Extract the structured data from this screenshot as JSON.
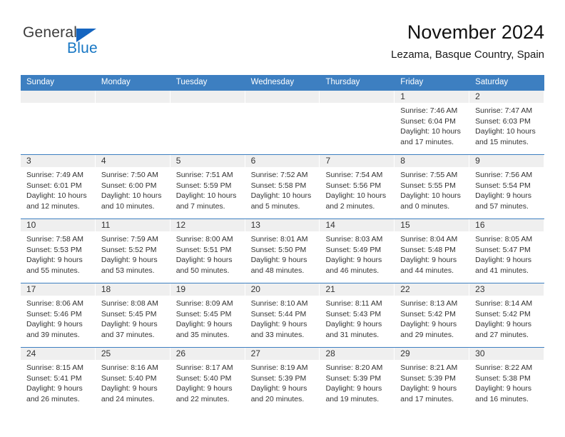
{
  "brand": {
    "name_part1": "General",
    "name_part2": "Blue"
  },
  "header": {
    "title": "November 2024",
    "subtitle": "Lezama, Basque Country, Spain"
  },
  "weekdays": [
    "Sunday",
    "Monday",
    "Tuesday",
    "Wednesday",
    "Thursday",
    "Friday",
    "Saturday"
  ],
  "colors": {
    "header_blue": "#3d7fc1",
    "band_gray": "#efefef",
    "brand_blue": "#1777c4",
    "logo_triangle": "#1565c0"
  },
  "weeks": [
    [
      {
        "day": "",
        "empty": true
      },
      {
        "day": "",
        "empty": true
      },
      {
        "day": "",
        "empty": true
      },
      {
        "day": "",
        "empty": true
      },
      {
        "day": "",
        "empty": true
      },
      {
        "day": "1",
        "sunrise": "Sunrise: 7:46 AM",
        "sunset": "Sunset: 6:04 PM",
        "daylight1": "Daylight: 10 hours",
        "daylight2": "and 17 minutes."
      },
      {
        "day": "2",
        "sunrise": "Sunrise: 7:47 AM",
        "sunset": "Sunset: 6:03 PM",
        "daylight1": "Daylight: 10 hours",
        "daylight2": "and 15 minutes."
      }
    ],
    [
      {
        "day": "3",
        "sunrise": "Sunrise: 7:49 AM",
        "sunset": "Sunset: 6:01 PM",
        "daylight1": "Daylight: 10 hours",
        "daylight2": "and 12 minutes."
      },
      {
        "day": "4",
        "sunrise": "Sunrise: 7:50 AM",
        "sunset": "Sunset: 6:00 PM",
        "daylight1": "Daylight: 10 hours",
        "daylight2": "and 10 minutes."
      },
      {
        "day": "5",
        "sunrise": "Sunrise: 7:51 AM",
        "sunset": "Sunset: 5:59 PM",
        "daylight1": "Daylight: 10 hours",
        "daylight2": "and 7 minutes."
      },
      {
        "day": "6",
        "sunrise": "Sunrise: 7:52 AM",
        "sunset": "Sunset: 5:58 PM",
        "daylight1": "Daylight: 10 hours",
        "daylight2": "and 5 minutes."
      },
      {
        "day": "7",
        "sunrise": "Sunrise: 7:54 AM",
        "sunset": "Sunset: 5:56 PM",
        "daylight1": "Daylight: 10 hours",
        "daylight2": "and 2 minutes."
      },
      {
        "day": "8",
        "sunrise": "Sunrise: 7:55 AM",
        "sunset": "Sunset: 5:55 PM",
        "daylight1": "Daylight: 10 hours",
        "daylight2": "and 0 minutes."
      },
      {
        "day": "9",
        "sunrise": "Sunrise: 7:56 AM",
        "sunset": "Sunset: 5:54 PM",
        "daylight1": "Daylight: 9 hours",
        "daylight2": "and 57 minutes."
      }
    ],
    [
      {
        "day": "10",
        "sunrise": "Sunrise: 7:58 AM",
        "sunset": "Sunset: 5:53 PM",
        "daylight1": "Daylight: 9 hours",
        "daylight2": "and 55 minutes."
      },
      {
        "day": "11",
        "sunrise": "Sunrise: 7:59 AM",
        "sunset": "Sunset: 5:52 PM",
        "daylight1": "Daylight: 9 hours",
        "daylight2": "and 53 minutes."
      },
      {
        "day": "12",
        "sunrise": "Sunrise: 8:00 AM",
        "sunset": "Sunset: 5:51 PM",
        "daylight1": "Daylight: 9 hours",
        "daylight2": "and 50 minutes."
      },
      {
        "day": "13",
        "sunrise": "Sunrise: 8:01 AM",
        "sunset": "Sunset: 5:50 PM",
        "daylight1": "Daylight: 9 hours",
        "daylight2": "and 48 minutes."
      },
      {
        "day": "14",
        "sunrise": "Sunrise: 8:03 AM",
        "sunset": "Sunset: 5:49 PM",
        "daylight1": "Daylight: 9 hours",
        "daylight2": "and 46 minutes."
      },
      {
        "day": "15",
        "sunrise": "Sunrise: 8:04 AM",
        "sunset": "Sunset: 5:48 PM",
        "daylight1": "Daylight: 9 hours",
        "daylight2": "and 44 minutes."
      },
      {
        "day": "16",
        "sunrise": "Sunrise: 8:05 AM",
        "sunset": "Sunset: 5:47 PM",
        "daylight1": "Daylight: 9 hours",
        "daylight2": "and 41 minutes."
      }
    ],
    [
      {
        "day": "17",
        "sunrise": "Sunrise: 8:06 AM",
        "sunset": "Sunset: 5:46 PM",
        "daylight1": "Daylight: 9 hours",
        "daylight2": "and 39 minutes."
      },
      {
        "day": "18",
        "sunrise": "Sunrise: 8:08 AM",
        "sunset": "Sunset: 5:45 PM",
        "daylight1": "Daylight: 9 hours",
        "daylight2": "and 37 minutes."
      },
      {
        "day": "19",
        "sunrise": "Sunrise: 8:09 AM",
        "sunset": "Sunset: 5:45 PM",
        "daylight1": "Daylight: 9 hours",
        "daylight2": "and 35 minutes."
      },
      {
        "day": "20",
        "sunrise": "Sunrise: 8:10 AM",
        "sunset": "Sunset: 5:44 PM",
        "daylight1": "Daylight: 9 hours",
        "daylight2": "and 33 minutes."
      },
      {
        "day": "21",
        "sunrise": "Sunrise: 8:11 AM",
        "sunset": "Sunset: 5:43 PM",
        "daylight1": "Daylight: 9 hours",
        "daylight2": "and 31 minutes."
      },
      {
        "day": "22",
        "sunrise": "Sunrise: 8:13 AM",
        "sunset": "Sunset: 5:42 PM",
        "daylight1": "Daylight: 9 hours",
        "daylight2": "and 29 minutes."
      },
      {
        "day": "23",
        "sunrise": "Sunrise: 8:14 AM",
        "sunset": "Sunset: 5:42 PM",
        "daylight1": "Daylight: 9 hours",
        "daylight2": "and 27 minutes."
      }
    ],
    [
      {
        "day": "24",
        "sunrise": "Sunrise: 8:15 AM",
        "sunset": "Sunset: 5:41 PM",
        "daylight1": "Daylight: 9 hours",
        "daylight2": "and 26 minutes."
      },
      {
        "day": "25",
        "sunrise": "Sunrise: 8:16 AM",
        "sunset": "Sunset: 5:40 PM",
        "daylight1": "Daylight: 9 hours",
        "daylight2": "and 24 minutes."
      },
      {
        "day": "26",
        "sunrise": "Sunrise: 8:17 AM",
        "sunset": "Sunset: 5:40 PM",
        "daylight1": "Daylight: 9 hours",
        "daylight2": "and 22 minutes."
      },
      {
        "day": "27",
        "sunrise": "Sunrise: 8:19 AM",
        "sunset": "Sunset: 5:39 PM",
        "daylight1": "Daylight: 9 hours",
        "daylight2": "and 20 minutes."
      },
      {
        "day": "28",
        "sunrise": "Sunrise: 8:20 AM",
        "sunset": "Sunset: 5:39 PM",
        "daylight1": "Daylight: 9 hours",
        "daylight2": "and 19 minutes."
      },
      {
        "day": "29",
        "sunrise": "Sunrise: 8:21 AM",
        "sunset": "Sunset: 5:39 PM",
        "daylight1": "Daylight: 9 hours",
        "daylight2": "and 17 minutes."
      },
      {
        "day": "30",
        "sunrise": "Sunrise: 8:22 AM",
        "sunset": "Sunset: 5:38 PM",
        "daylight1": "Daylight: 9 hours",
        "daylight2": "and 16 minutes."
      }
    ]
  ]
}
